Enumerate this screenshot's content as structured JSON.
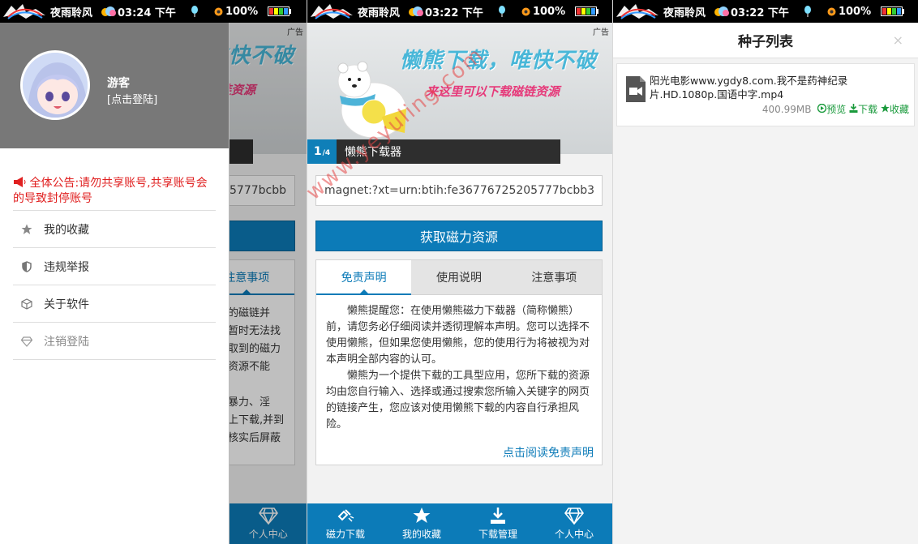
{
  "status_bar": {
    "app_name": "夜雨聆风",
    "time_1": "03:24 下午",
    "time_2": "03:22 下午",
    "time_3": "03:22 下午",
    "battery": "100%"
  },
  "ad_label": "广告",
  "banner": {
    "index": "1",
    "total": "/4",
    "label": "懒熊下载器",
    "title": "懒熊下载，唯快不破",
    "subtitle": "来这里可以下载磁链资源"
  },
  "search": {
    "value": "magnet:?xt=urn:btih:fe36776725205777bcbb3",
    "partial_value": "5777bcbb"
  },
  "fetch_button": "获取磁力资源",
  "tabs": [
    "免责声明",
    "使用说明",
    "注意事项"
  ],
  "disclaimer": {
    "p1": "懒熊提醒您：在使用懒熊磁力下载器（简称懒熊）前，请您务必仔细阅读并透彻理解本声明。您可以选择不使用懒熊，但如果您使用懒熊，您的使用行为将被视为对本声明全部内容的认可。",
    "p2": "懒熊为一个提供下载的工具型应用，您所下载的资源均由您自行输入、选择或通过搜索您所输入关键字的网页的链接产生，您应该对使用懒熊下载的内容自行承担风险。",
    "more": "点击阅读免责声明"
  },
  "bg_notes": {
    "l1": "的磁链并",
    "l2": "暂时无法找",
    "l3": "取到的磁力",
    "l4": "资源不能",
    "l5": "暴力、淫",
    "l6": "上下载,并到",
    "l7": "核实后屏蔽"
  },
  "bottom_nav": [
    "磁力下载",
    "我的收藏",
    "下载管理",
    "个人中心"
  ],
  "drawer": {
    "username": "游客",
    "login_hint": "[点击登陆]",
    "notice": "全体公告:请勿共享账号,共享账号会的导致封停账号",
    "menu": [
      "我的收藏",
      "违规举报",
      "关于软件",
      "注销登陆"
    ]
  },
  "torrent_list": {
    "title": "种子列表",
    "close": "×",
    "items": [
      {
        "name": "阳光电影www.ygdy8.com.我不是药神纪录片.HD.1080p.国语中字.mp4",
        "size": "400.99MB",
        "preview": "预览",
        "download": "下载",
        "favorite": "收藏"
      }
    ]
  },
  "watermark": "www.yeyuling.com",
  "colors": {
    "primary": "#0c7bb8",
    "notice_red": "#e02020",
    "action_green": "#1a9a3c"
  }
}
